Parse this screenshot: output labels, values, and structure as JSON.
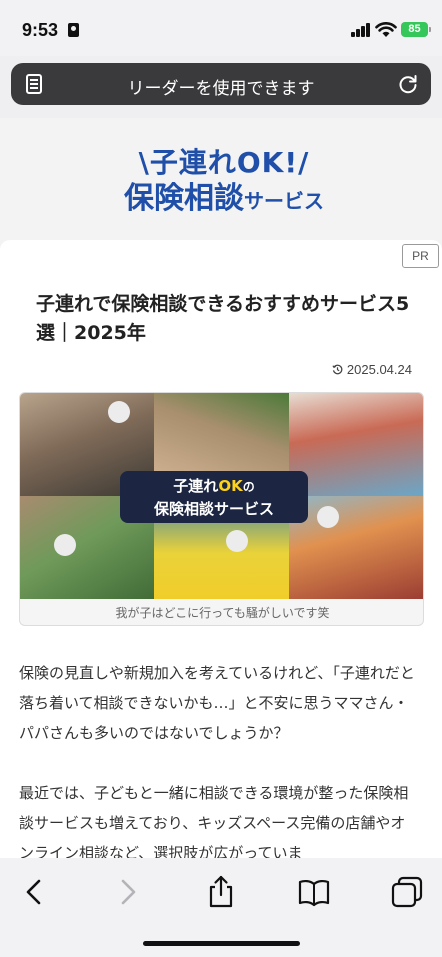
{
  "status_bar": {
    "time": "9:53",
    "battery": "85"
  },
  "address_bar": {
    "text": "リーダーを使用できます"
  },
  "logo": {
    "line1": "\\子連れOK!/",
    "line2_main": "保険相談",
    "line2_small": "サービス"
  },
  "article": {
    "pr_badge": "PR",
    "title": "子連れで保険相談できるおすすめサービス5選｜2025年",
    "date": "2025.04.24",
    "image_overlay_line1_a": "子連れ",
    "image_overlay_line1_b": "OK",
    "image_overlay_line1_c": "の",
    "image_overlay_line2": "保険相談サービス",
    "image_caption": "我が子はどこに行っても騒がしいです笑",
    "paragraphs": [
      "保険の見直しや新規加入を考えているけれど、「子連れだと落ち着いて相談できないかも…」と不安に思うママさん・パパさんも多いのではないでしょうか？",
      "最近では、子どもと一緒に相談できる環境が整った保険相談サービスも増えており、キッズスペース完備の店舗やオンライン相談など、選択肢が広がっていま"
    ]
  },
  "colors": {
    "brand_blue": "#1f4fa8",
    "overlay_bg": "#1c2541",
    "overlay_accent": "#ffd21a",
    "battery_green": "#35c759"
  },
  "toolbar": {
    "icons": [
      "back-icon",
      "forward-icon",
      "share-icon",
      "bookmarks-icon",
      "tabs-icon"
    ]
  }
}
